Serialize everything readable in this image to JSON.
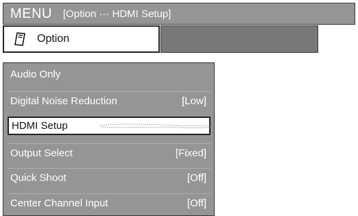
{
  "header": {
    "menu_label": "MENU",
    "breadcrumb": "[Option ··· HDMI Setup]"
  },
  "option_tab": {
    "icon": "remote-card-icon",
    "label": "Option"
  },
  "menu_items": [
    {
      "label": "Audio Only",
      "value": ""
    },
    {
      "label": "Digital Noise Reduction",
      "value": "[Low]"
    },
    {
      "label": "HDMI Setup",
      "value": "",
      "selected": true
    },
    {
      "label": "Output Select",
      "value": "[Fixed]"
    },
    {
      "label": "Quick Shoot",
      "value": "[Off]"
    },
    {
      "label": "Center Channel Input",
      "value": "[Off]"
    }
  ]
}
